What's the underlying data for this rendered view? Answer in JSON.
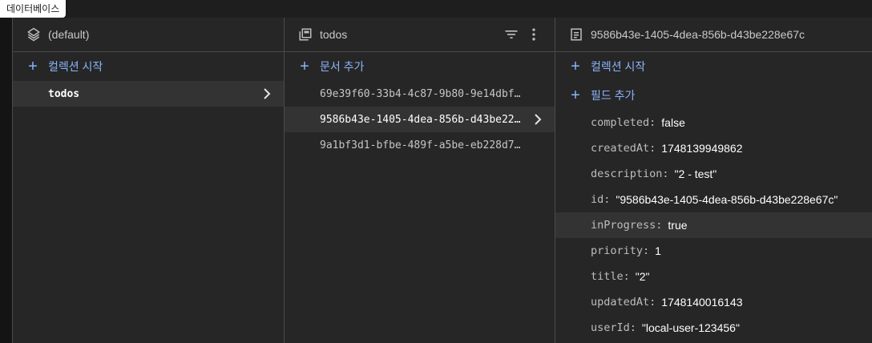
{
  "tooltip": "데이터베이스",
  "panel_database": {
    "title": "(default)",
    "add_label": "컬렉션 시작",
    "items": [
      {
        "label": "todos",
        "selected": true
      }
    ]
  },
  "panel_collection": {
    "title": "todos",
    "add_label": "문서 추가",
    "items": [
      {
        "label": "69e39f60-33b4-4c87-9b80-9e14dbf…",
        "selected": false
      },
      {
        "label": "9586b43e-1405-4dea-856b-d43be22…",
        "selected": true
      },
      {
        "label": "9a1bf3d1-bfbe-489f-a5be-eb228d7…",
        "selected": false
      }
    ]
  },
  "panel_document": {
    "title": "9586b43e-1405-4dea-856b-d43be228e67c",
    "add_collection_label": "컬렉션 시작",
    "add_field_label": "필드 추가",
    "fields": [
      {
        "key": "completed:",
        "value": "false"
      },
      {
        "key": "createdAt:",
        "value": "1748139949862"
      },
      {
        "key": "description:",
        "value": "\"2 - test\""
      },
      {
        "key": "id:",
        "value": "\"9586b43e-1405-4dea-856b-d43be228e67c\""
      },
      {
        "key": "inProgress:",
        "value": "true"
      },
      {
        "key": "priority:",
        "value": "1"
      },
      {
        "key": "title:",
        "value": "\"2\""
      },
      {
        "key": "updatedAt:",
        "value": "1748140016143"
      },
      {
        "key": "userId:",
        "value": "\"local-user-123456\""
      }
    ]
  },
  "colors": {
    "accent": "#8ab4f8",
    "panel_bg": "#262626",
    "selected_bg": "#333333"
  },
  "icons": {
    "database": "layers-icon",
    "collection": "collection-icon",
    "document": "document-icon",
    "filter": "filter-icon",
    "more": "more-vert-icon",
    "chevron": "chevron-right-icon"
  }
}
